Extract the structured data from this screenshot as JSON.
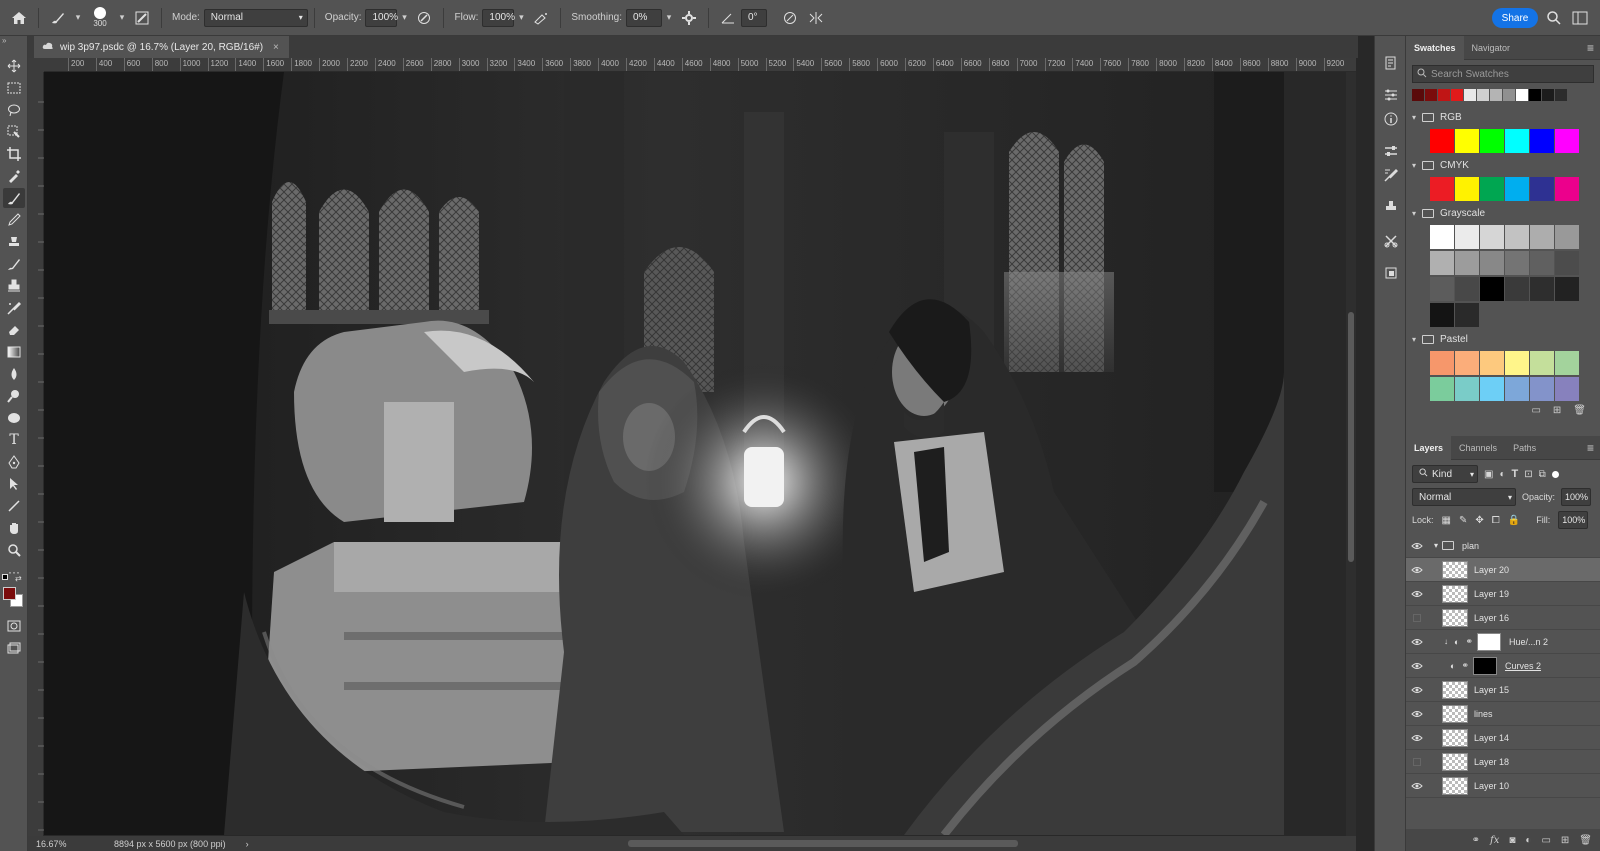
{
  "options_bar": {
    "brush_size": "300",
    "mode_label": "Mode:",
    "mode_value": "Normal",
    "opacity_label": "Opacity:",
    "opacity_value": "100%",
    "flow_label": "Flow:",
    "flow_value": "100%",
    "smoothing_label": "Smoothing:",
    "smoothing_value": "0%",
    "angle_value": "0°",
    "share_label": "Share"
  },
  "document_tab": {
    "title": "wip 3p97.psdc @ 16.7% (Layer 20, RGB/16#)",
    "close_glyph": "×"
  },
  "ruler_ticks": [
    "200",
    "400",
    "600",
    "800",
    "1000",
    "1200",
    "1400",
    "1600",
    "1800",
    "2000",
    "2200",
    "2400",
    "2600",
    "2800",
    "3000",
    "3200",
    "3400",
    "3600",
    "3800",
    "4000",
    "4200",
    "4400",
    "4600",
    "4800",
    "5000",
    "5200",
    "5400",
    "5600",
    "5800",
    "6000",
    "6200",
    "6400",
    "6600",
    "6800",
    "7000",
    "7200",
    "7400",
    "7600",
    "7800",
    "8000",
    "8200",
    "8400",
    "8600",
    "8800",
    "9000",
    "9200"
  ],
  "status": {
    "zoom": "16.67%",
    "dimensions": "8894 px x 5600 px (800 ppi)",
    "arrow": "›"
  },
  "swatches_panel": {
    "tabs": [
      "Swatches",
      "Navigator"
    ],
    "search_placeholder": "Search Swatches",
    "recent": [
      "#5a0a0a",
      "#7a0c0c",
      "#c01515",
      "#e01a1a",
      "#e8e8e8",
      "#d0d0d0",
      "#b4b4b4",
      "#909090",
      "#ffffff",
      "#000000",
      "#1c1c1c",
      "#2c2c2c"
    ],
    "groups": [
      {
        "name": "RGB",
        "colors": [
          [
            "#ff0000",
            "#ffff00",
            "#00ff00",
            "#00ffff",
            "#0000ff",
            "#ff00ff"
          ]
        ]
      },
      {
        "name": "CMYK",
        "colors": [
          [
            "#ec1c24",
            "#fff200",
            "#00a651",
            "#00aeef",
            "#2e3192",
            "#ec008c"
          ]
        ]
      },
      {
        "name": "Grayscale",
        "colors": [
          [
            "#ffffff",
            "#ebebeb",
            "#d6d6d6",
            "#c2c2c2",
            "#adadad",
            "#999999"
          ],
          [
            "#b0b0b0",
            "#9c9c9c",
            "#888888",
            "#747474",
            "#606060",
            "#4c4c4c"
          ],
          [
            "#5c5c5c",
            "#484848",
            "#000000",
            "#3a3a3a",
            "#2e2e2e",
            "#222222"
          ],
          [
            "#141414",
            "#2a2a2a"
          ]
        ]
      },
      {
        "name": "Pastel",
        "colors": [
          [
            "#f6976b",
            "#fbad7a",
            "#fdc97e",
            "#fff58a",
            "#c4df9b",
            "#a3d39c"
          ],
          [
            "#7bcc9c",
            "#7accc8",
            "#6dcff6",
            "#7da7d9",
            "#8393ca",
            "#8781bd"
          ]
        ]
      }
    ]
  },
  "layers_panel": {
    "tabs": [
      "Layers",
      "Channels",
      "Paths"
    ],
    "kind_label": "Kind",
    "blend_mode": "Normal",
    "opacity_label": "Opacity:",
    "opacity_value": "100%",
    "lock_label": "Lock:",
    "fill_label": "Fill:",
    "fill_value": "100%",
    "layers": [
      {
        "name": "plan",
        "visible": true,
        "type": "group"
      },
      {
        "name": "Layer 20",
        "visible": true,
        "type": "layer",
        "selected": true
      },
      {
        "name": "Layer 19",
        "visible": true,
        "type": "layer"
      },
      {
        "name": "Layer 16",
        "visible": false,
        "type": "layer"
      },
      {
        "name": "Hue/...n 2",
        "visible": true,
        "type": "adjustment-white"
      },
      {
        "name": "Curves 2",
        "visible": true,
        "type": "adjustment-black"
      },
      {
        "name": "Layer 15",
        "visible": true,
        "type": "layer"
      },
      {
        "name": "lines",
        "visible": true,
        "type": "layer"
      },
      {
        "name": "Layer 14",
        "visible": true,
        "type": "layer"
      },
      {
        "name": "Layer 18",
        "visible": false,
        "type": "layer"
      },
      {
        "name": "Layer 10",
        "visible": true,
        "type": "layer"
      }
    ]
  },
  "colors": {
    "accent": "#1473e6",
    "foreground_color": "#7a0c0c",
    "background_color": "#ffffff"
  }
}
